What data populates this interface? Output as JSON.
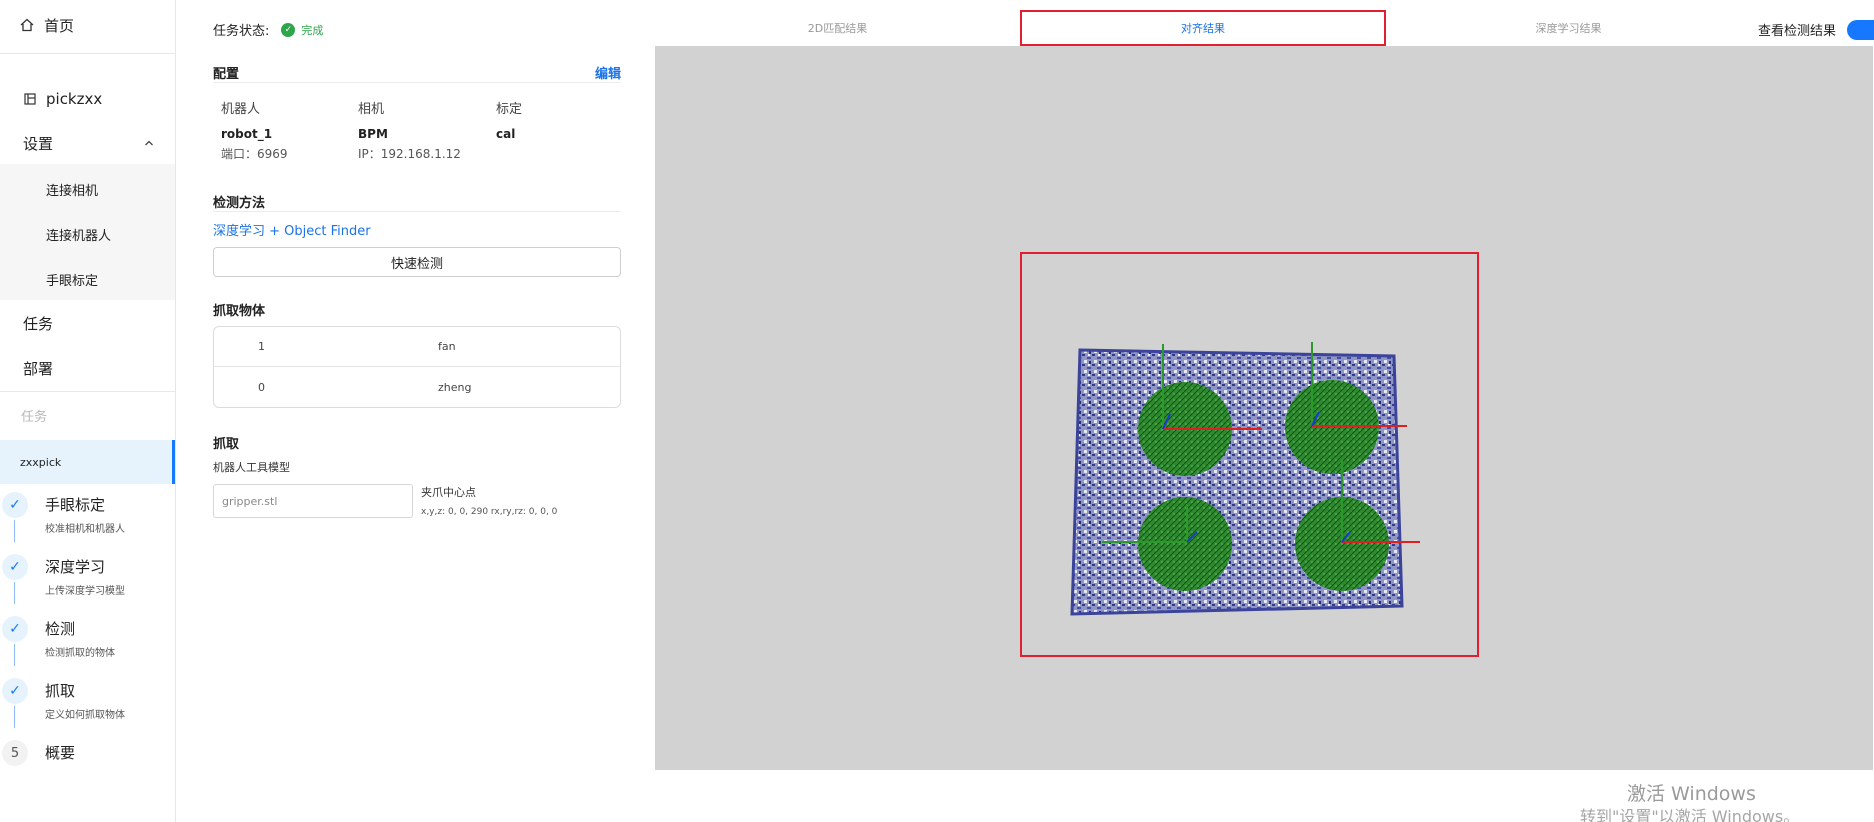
{
  "sidebar": {
    "home_label": "首页",
    "project_label": "pickzxx",
    "settings_label": "设置",
    "settings_items": [
      "连接相机",
      "连接机器人",
      "手眼标定"
    ],
    "task_label": "任务",
    "deploy_label": "部署",
    "task_section_label": "任务",
    "active_task": "zxxpick",
    "steps": [
      {
        "title": "手眼标定",
        "desc": "校准相机和机器人",
        "marker": "✓"
      },
      {
        "title": "深度学习",
        "desc": "上传深度学习模型",
        "marker": "✓"
      },
      {
        "title": "检测",
        "desc": "检测抓取的物体",
        "marker": "✓"
      },
      {
        "title": "抓取",
        "desc": "定义如何抓取物体",
        "marker": "✓"
      },
      {
        "title": "概要",
        "desc": "",
        "marker": "5"
      }
    ]
  },
  "panel": {
    "status_label": "任务状态:",
    "status_value": "完成",
    "config_title": "配置",
    "edit_label": "编辑",
    "config": [
      {
        "head": "机器人",
        "value": "robot_1",
        "sub": "端口：6969"
      },
      {
        "head": "相机",
        "value": "BPM",
        "sub": "IP：192.168.1.12"
      },
      {
        "head": "标定",
        "value": "cal",
        "sub": ""
      }
    ],
    "detect_title": "检测方法",
    "detect_method": "深度学习 + Object Finder",
    "quick_detect_label": "快速检测",
    "objects_title": "抓取物体",
    "objects": [
      {
        "id": "1",
        "name": "fan"
      },
      {
        "id": "0",
        "name": "zheng"
      }
    ],
    "grab_title": "抓取",
    "tool_model_label": "机器人工具模型",
    "tool_model_value": "gripper.stl",
    "center_label": "夹爪中心点",
    "center_value": "x,y,z: 0, 0, 290 rx,ry,rz: 0, 0, 0"
  },
  "viewer": {
    "tabs": [
      "2D匹配结果",
      "对齐结果",
      "深度学习结果"
    ],
    "active_tab": 1,
    "toggle_label": "查看检测结果",
    "toggle_on": true,
    "accent": "#1677ff",
    "highlight": "#e0202e"
  },
  "watermark": {
    "line1": "激活 Windows",
    "line2": "转到\"设置\"以激活 Windows。"
  }
}
